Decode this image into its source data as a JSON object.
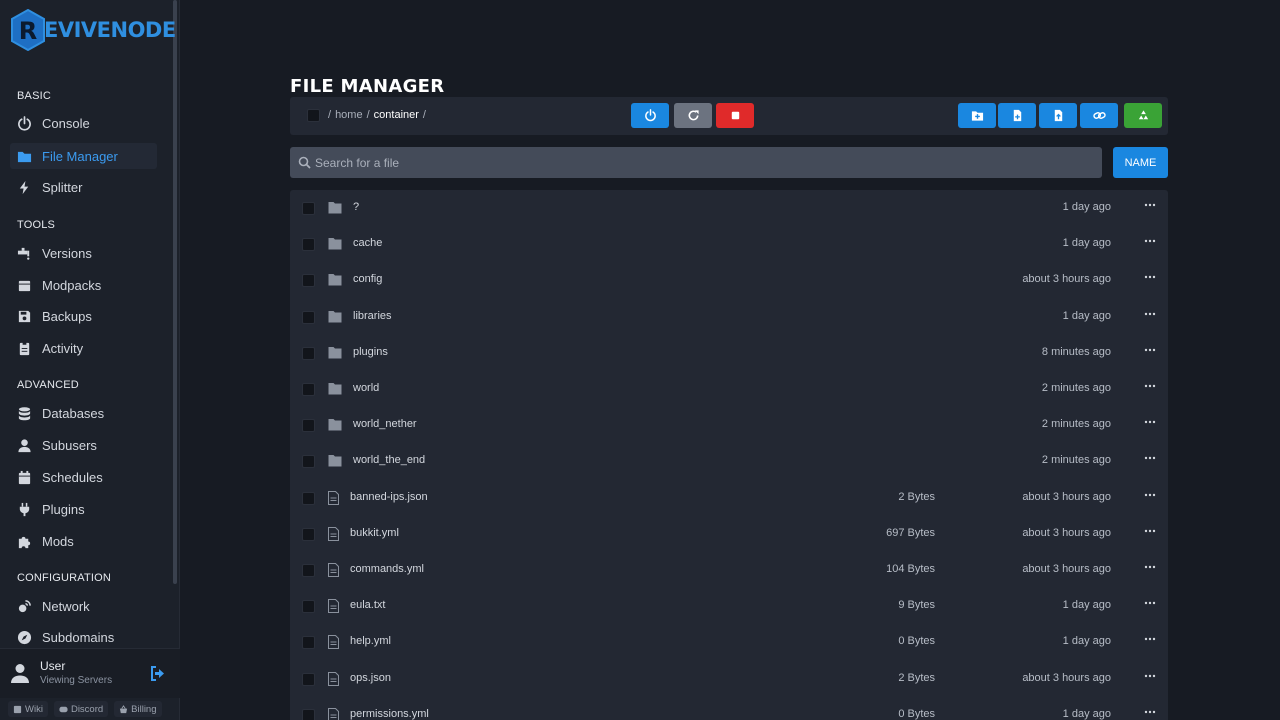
{
  "brand": {
    "logo_text": "EVIVENODE",
    "badge_letter": "R"
  },
  "sidebar": {
    "sections": [
      {
        "label": "BASIC",
        "items": [
          {
            "label": "Console",
            "icon": "power-icon"
          },
          {
            "label": "File Manager",
            "icon": "folder-icon",
            "active": true
          },
          {
            "label": "Splitter",
            "icon": "bolt-icon"
          }
        ]
      },
      {
        "label": "TOOLS",
        "items": [
          {
            "label": "Versions",
            "icon": "faucet-icon"
          },
          {
            "label": "Modpacks",
            "icon": "box-icon"
          },
          {
            "label": "Backups",
            "icon": "floppy-icon"
          },
          {
            "label": "Activity",
            "icon": "clipboard-icon"
          }
        ]
      },
      {
        "label": "ADVANCED",
        "items": [
          {
            "label": "Databases",
            "icon": "database-icon"
          },
          {
            "label": "Subusers",
            "icon": "user-icon"
          },
          {
            "label": "Schedules",
            "icon": "calendar-icon"
          },
          {
            "label": "Plugins",
            "icon": "plug-icon"
          },
          {
            "label": "Mods",
            "icon": "puzzle-icon"
          }
        ]
      },
      {
        "label": "CONFIGURATION",
        "items": [
          {
            "label": "Network",
            "icon": "satellite-icon"
          },
          {
            "label": "Subdomains",
            "icon": "compass-icon"
          }
        ]
      }
    ]
  },
  "user": {
    "name": "User",
    "subtitle": "Viewing Servers"
  },
  "footer": {
    "wiki": "Wiki",
    "discord": "Discord",
    "billing": "Billing"
  },
  "main": {
    "title": "FILE MANAGER",
    "breadcrumb": {
      "sep": "/",
      "home": "home",
      "current": "container"
    },
    "search_placeholder": "Search for a file",
    "sort_label": "NAME",
    "colors": {
      "blue": "#1a87e0",
      "grey": "#6c7380",
      "red": "#e02a2a",
      "green": "#3aa336"
    }
  },
  "files": [
    {
      "name": "?",
      "type": "folder",
      "size": "",
      "modified": "1 day ago"
    },
    {
      "name": "cache",
      "type": "folder",
      "size": "",
      "modified": "1 day ago"
    },
    {
      "name": "config",
      "type": "folder",
      "size": "",
      "modified": "about 3 hours ago"
    },
    {
      "name": "libraries",
      "type": "folder",
      "size": "",
      "modified": "1 day ago"
    },
    {
      "name": "plugins",
      "type": "folder",
      "size": "",
      "modified": "8 minutes ago"
    },
    {
      "name": "world",
      "type": "folder",
      "size": "",
      "modified": "2 minutes ago"
    },
    {
      "name": "world_nether",
      "type": "folder",
      "size": "",
      "modified": "2 minutes ago"
    },
    {
      "name": "world_the_end",
      "type": "folder",
      "size": "",
      "modified": "2 minutes ago"
    },
    {
      "name": "banned-ips.json",
      "type": "file",
      "size": "2 Bytes",
      "modified": "about 3 hours ago"
    },
    {
      "name": "bukkit.yml",
      "type": "file",
      "size": "697 Bytes",
      "modified": "about 3 hours ago"
    },
    {
      "name": "commands.yml",
      "type": "file",
      "size": "104 Bytes",
      "modified": "about 3 hours ago"
    },
    {
      "name": "eula.txt",
      "type": "file",
      "size": "9 Bytes",
      "modified": "1 day ago"
    },
    {
      "name": "help.yml",
      "type": "file",
      "size": "0 Bytes",
      "modified": "1 day ago"
    },
    {
      "name": "ops.json",
      "type": "file",
      "size": "2 Bytes",
      "modified": "about 3 hours ago"
    },
    {
      "name": "permissions.yml",
      "type": "file",
      "size": "0 Bytes",
      "modified": "1 day ago"
    }
  ]
}
